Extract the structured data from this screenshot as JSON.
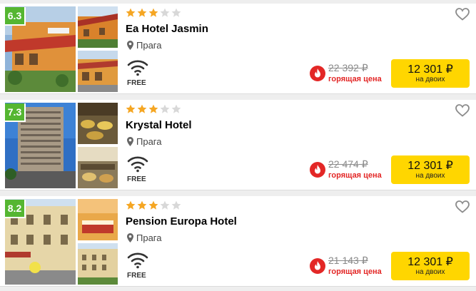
{
  "colors": {
    "rating_bg": "#55b631",
    "star_filled": "#f5a623",
    "star_empty": "#d8d8d8",
    "hot_red": "#e32726",
    "button_yellow": "#ffd600"
  },
  "icons": {
    "star": "star-icon",
    "location": "map-pin-icon",
    "wifi": "wifi-icon",
    "hot": "fire-icon",
    "favorite": "heart-icon"
  },
  "hotels": [
    {
      "rating": "6.3",
      "stars": 3,
      "max_stars": 5,
      "name": "Ea Hotel Jasmin",
      "city": "Прага",
      "wifi": "FREE",
      "old_price": "22 392 ₽",
      "hot_label": "горящая цена",
      "price": "12 301 ₽",
      "price_note": "на двоих"
    },
    {
      "rating": "7.3",
      "stars": 3,
      "max_stars": 5,
      "name": "Krystal Hotel",
      "city": "Прага",
      "wifi": "FREE",
      "old_price": "22 474 ₽",
      "hot_label": "горящая цена",
      "price": "12 301 ₽",
      "price_note": "на двоих"
    },
    {
      "rating": "8.2",
      "stars": 3,
      "max_stars": 5,
      "name": "Pension Europa Hotel",
      "city": "Прага",
      "wifi": "FREE",
      "old_price": "21 143 ₽",
      "hot_label": "горящая цена",
      "price": "12 301 ₽",
      "price_note": "на двоих"
    }
  ]
}
